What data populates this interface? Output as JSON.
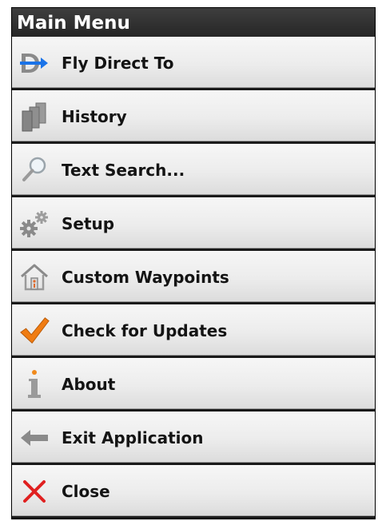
{
  "menu": {
    "title": "Main Menu",
    "items": [
      {
        "label": "Fly Direct To",
        "icon": "direct-to-icon"
      },
      {
        "label": "History",
        "icon": "history-icon"
      },
      {
        "label": "Text Search...",
        "icon": "magnifier-icon"
      },
      {
        "label": "Setup",
        "icon": "gears-icon"
      },
      {
        "label": "Custom Waypoints",
        "icon": "house-waypoint-icon"
      },
      {
        "label": "Check for Updates",
        "icon": "checkmark-icon"
      },
      {
        "label": "About",
        "icon": "info-icon"
      },
      {
        "label": "Exit Application",
        "icon": "arrow-left-icon"
      },
      {
        "label": "Close",
        "icon": "close-x-icon"
      }
    ]
  },
  "colors": {
    "header_bg": "#2e2e2e",
    "direct_to_blue": "#1a73e8",
    "checkmark_orange": "#f07c12",
    "info_orange": "#f08a1c",
    "close_red": "#e02020",
    "icon_gray": "#8a8a8a"
  }
}
